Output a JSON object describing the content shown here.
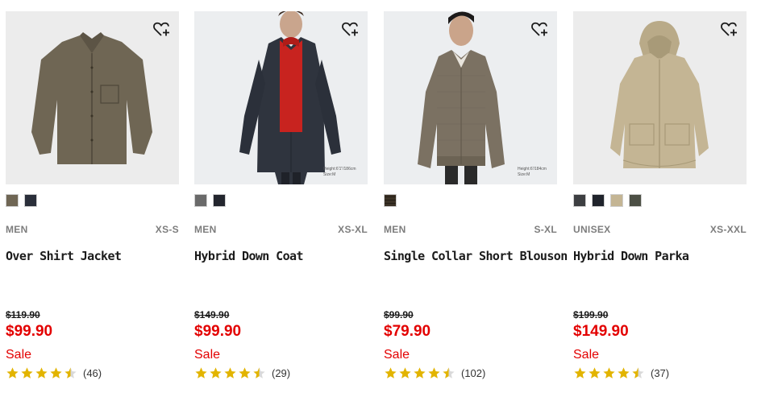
{
  "products": [
    {
      "name": "Over Shirt Jacket",
      "gender": "MEN",
      "sizes": "XS-S",
      "original_price": "$119.90",
      "price": "$99.90",
      "sale_label": "Sale",
      "rating": 4.5,
      "reviews": "(46)",
      "colors": [
        "#6f6654",
        "#2a2f3a"
      ],
      "image_bg": "#ececec"
    },
    {
      "name": "Hybrid Down Coat",
      "gender": "MEN",
      "sizes": "XS-XL",
      "original_price": "$149.90",
      "price": "$99.90",
      "sale_label": "Sale",
      "rating": 4.5,
      "reviews": "(29)",
      "colors": [
        "#6a6a6a",
        "#23262e"
      ],
      "image_bg": "#eceef0",
      "caption": "Height:6'1\"/186cm Size:M"
    },
    {
      "name": "Single Collar Short Blouson",
      "gender": "MEN",
      "sizes": "S-XL",
      "original_price": "$99.90",
      "price": "$79.90",
      "sale_label": "Sale",
      "rating": 4.5,
      "reviews": "(102)",
      "colors": [
        "#7b7162"
      ],
      "image_bg": "#eceef0",
      "caption": "Height:6'/184cm Size:M"
    },
    {
      "name": "Hybrid Down Parka",
      "gender": "UNISEX",
      "sizes": "XS-XXL",
      "original_price": "$199.90",
      "price": "$149.90",
      "sale_label": "Sale",
      "rating": 4.5,
      "reviews": "(37)",
      "colors": [
        "#3d3f42",
        "#20242c",
        "#c4b594",
        "#4c4f45"
      ],
      "image_bg": "#ececec"
    }
  ],
  "icons": {
    "wishlist": "heart-plus-icon",
    "star": "star-icon"
  },
  "colors": {
    "sale_red": "#e30000",
    "star_gold": "#e2b400"
  }
}
